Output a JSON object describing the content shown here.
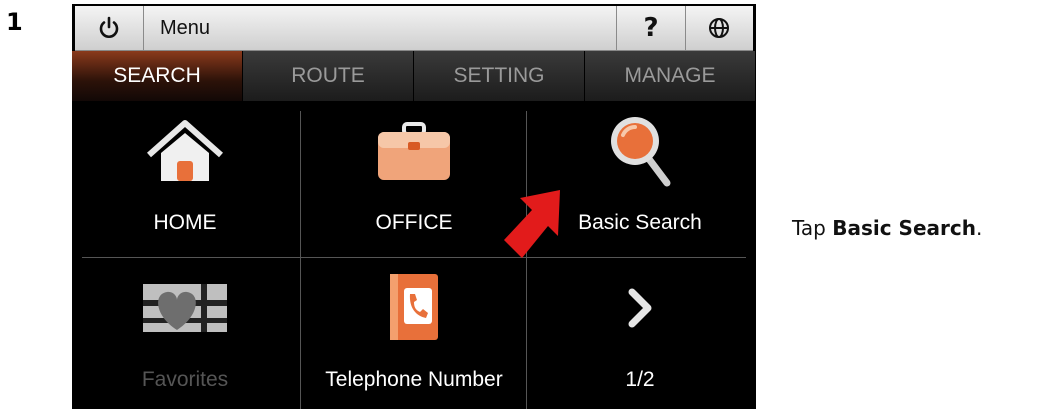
{
  "step": {
    "number": "1"
  },
  "topbar": {
    "menu_label": "Menu",
    "help_label": "?"
  },
  "tabs": [
    {
      "label": "SEARCH",
      "active": true
    },
    {
      "label": "ROUTE",
      "active": false
    },
    {
      "label": "SETTING",
      "active": false
    },
    {
      "label": "MANAGE",
      "active": false
    }
  ],
  "tiles": [
    {
      "label": "HOME",
      "icon": "home-icon",
      "enabled": true
    },
    {
      "label": "OFFICE",
      "icon": "briefcase-icon",
      "enabled": true
    },
    {
      "label": "Basic Search",
      "icon": "magnifier-icon",
      "enabled": true
    },
    {
      "label": "Favorites",
      "icon": "favorites-heart-icon",
      "enabled": false
    },
    {
      "label": "Telephone Number",
      "icon": "phone-book-icon",
      "enabled": true
    },
    {
      "label": "1/2",
      "icon": "chevron-right-icon",
      "enabled": true
    }
  ],
  "instruction": {
    "prefix": "Tap ",
    "target": "Basic Search",
    "suffix": "."
  },
  "colors": {
    "accent": "#e8703a",
    "pointer": "#e21b1b",
    "active_tab": "#8a3a1c"
  }
}
